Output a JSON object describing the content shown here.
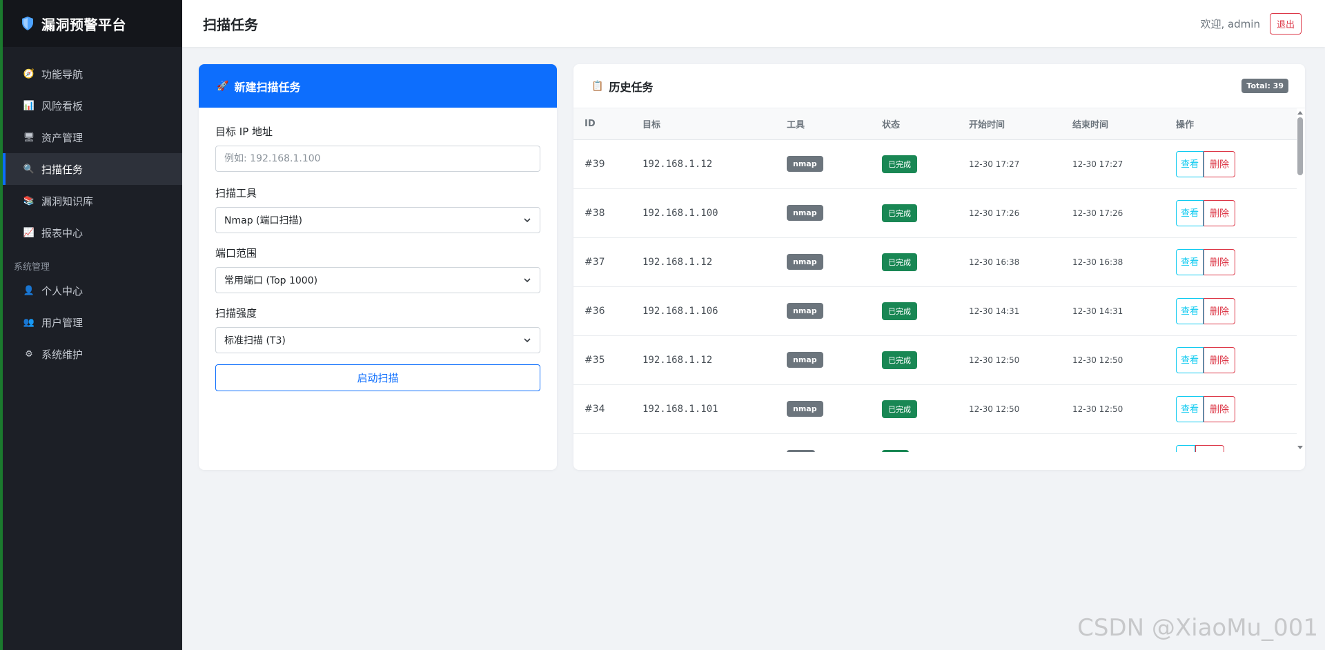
{
  "sidebar": {
    "brand": "漏洞预警平台",
    "items": [
      {
        "label": "功能导航",
        "icon": "compass-icon",
        "glyph": "🧭"
      },
      {
        "label": "风险看板",
        "icon": "chart-icon",
        "glyph": "📊"
      },
      {
        "label": "资产管理",
        "icon": "computer-icon",
        "glyph": "🖥"
      },
      {
        "label": "扫描任务",
        "icon": "search-icon",
        "glyph": "🔍",
        "active": true
      },
      {
        "label": "漏洞知识库",
        "icon": "books-icon",
        "glyph": "📚"
      },
      {
        "label": "报表中心",
        "icon": "trend-icon",
        "glyph": "📈"
      }
    ],
    "section_title": "系统管理",
    "system_items": [
      {
        "label": "个人中心",
        "icon": "user-icon",
        "glyph": "👤"
      },
      {
        "label": "用户管理",
        "icon": "users-icon",
        "glyph": "👥"
      },
      {
        "label": "系统维护",
        "icon": "gear-icon",
        "glyph": "⚙"
      }
    ]
  },
  "header": {
    "title": "扫描任务",
    "welcome": "欢迎, admin",
    "logout": "退出"
  },
  "new_task": {
    "title": "新建扫描任务",
    "icon": "rocket-icon",
    "target_label": "目标 IP 地址",
    "target_placeholder": "例如: 192.168.1.100",
    "tool_label": "扫描工具",
    "tool_value": "Nmap (端口扫描)",
    "port_label": "端口范围",
    "port_value": "常用端口 (Top 1000)",
    "intensity_label": "扫描强度",
    "intensity_value": "标准扫描 (T3)",
    "start_button": "启动扫描"
  },
  "history": {
    "title": "历史任务",
    "icon": "clipboard-icon",
    "total": "Total: 39",
    "columns": [
      "ID",
      "目标",
      "工具",
      "状态",
      "开始时间",
      "结束时间",
      "操作"
    ],
    "view_label": "查看",
    "delete_label": "删除",
    "rows": [
      {
        "id": "#39",
        "target": "192.168.1.12",
        "tool": "nmap",
        "status": "已完成",
        "start": "12-30 17:27",
        "end": "12-30 17:27"
      },
      {
        "id": "#38",
        "target": "192.168.1.100",
        "tool": "nmap",
        "status": "已完成",
        "start": "12-30 17:26",
        "end": "12-30 17:26"
      },
      {
        "id": "#37",
        "target": "192.168.1.12",
        "tool": "nmap",
        "status": "已完成",
        "start": "12-30 16:38",
        "end": "12-30 16:38"
      },
      {
        "id": "#36",
        "target": "192.168.1.106",
        "tool": "nmap",
        "status": "已完成",
        "start": "12-30 14:31",
        "end": "12-30 14:31"
      },
      {
        "id": "#35",
        "target": "192.168.1.12",
        "tool": "nmap",
        "status": "已完成",
        "start": "12-30 12:50",
        "end": "12-30 12:50"
      },
      {
        "id": "#34",
        "target": "192.168.1.101",
        "tool": "nmap",
        "status": "已完成",
        "start": "12-30 12:50",
        "end": "12-30 12:50"
      }
    ]
  },
  "watermark": "CSDN @XiaoMu_001",
  "colors": {
    "primary": "#0d6efd",
    "danger": "#dc3545",
    "success": "#198754",
    "info": "#0dcaf0",
    "sidebar_bg": "#1c1f26"
  }
}
